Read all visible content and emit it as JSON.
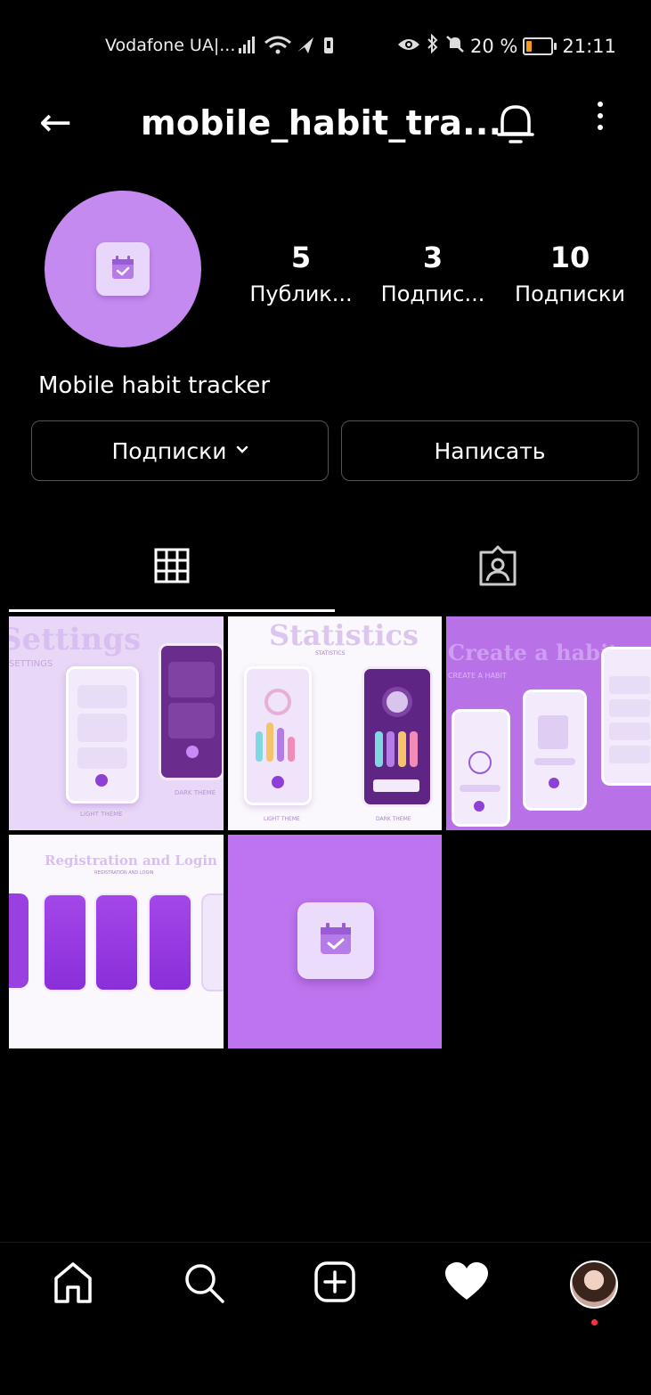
{
  "status_bar": {
    "carrier": "Vodafone UA|...",
    "battery_text": "20 %",
    "time": "21:11",
    "battery_level": 0.2,
    "battery_color": "#f39a1e"
  },
  "header": {
    "back_glyph": "←",
    "username": "mobile_habit_tra..."
  },
  "profile": {
    "avatar_color": "#c58af0",
    "name": "Mobile habit tracker",
    "stats": [
      {
        "count": "5",
        "label": "Публик..."
      },
      {
        "count": "3",
        "label": "Подпис..."
      },
      {
        "count": "10",
        "label": "Подписки"
      }
    ]
  },
  "actions": {
    "following_label": "Подписки",
    "message_label": "Написать"
  },
  "tabs": [
    {
      "name": "grid-tab",
      "icon": "grid-icon",
      "active": true
    },
    {
      "name": "tagged-tab",
      "icon": "tagged-person-icon",
      "active": false
    }
  ],
  "posts": [
    {
      "title": "Settings",
      "subtitle": "SETTINGS",
      "left_caption": "LIGHT THEME",
      "right_caption": "DARK THEME"
    },
    {
      "title": "Statistics",
      "subtitle": "STATISTICS",
      "left_caption": "LIGHT THEME",
      "right_caption": "DARK THEME"
    },
    {
      "title": "Create a habit",
      "subtitle": "CREATE A HABIT"
    },
    {
      "title": "Registration and Login",
      "subtitle": "REGISTRATION AND LOGIN"
    },
    {
      "title": "",
      "subtitle": ""
    }
  ],
  "bottom_nav": [
    {
      "name": "home-icon"
    },
    {
      "name": "search-icon"
    },
    {
      "name": "add-post-icon"
    },
    {
      "name": "heart-icon"
    },
    {
      "name": "profile-avatar"
    }
  ]
}
